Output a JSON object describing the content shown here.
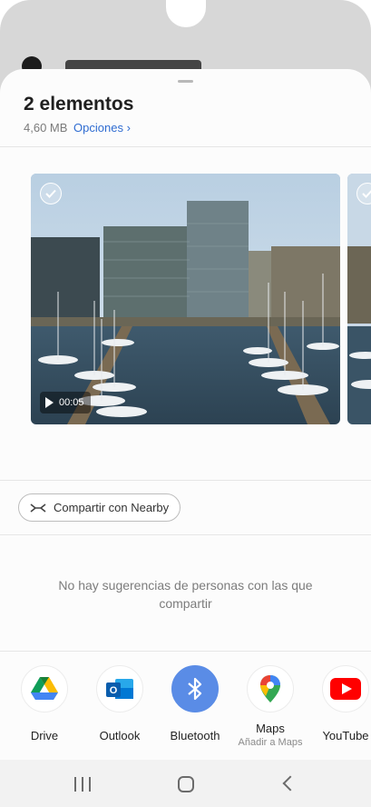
{
  "sheet": {
    "title": "2 elementos",
    "size": "4,60 MB",
    "options_label": "Opciones",
    "options_chevron": "›"
  },
  "media": [
    {
      "selected": false,
      "duration": "00:05",
      "type": "video"
    },
    {
      "selected": false,
      "type": "video"
    }
  ],
  "nearby": {
    "label": "Compartir con Nearby",
    "icon": "nearby-share-icon"
  },
  "suggestions": {
    "empty_text": "No hay sugerencias de personas con las que compartir"
  },
  "apps": [
    {
      "label": "Drive",
      "icon": "google-drive-icon"
    },
    {
      "label": "Outlook",
      "icon": "outlook-icon"
    },
    {
      "label": "Bluetooth",
      "icon": "bluetooth-icon",
      "color": "#5a8ce6"
    },
    {
      "label": "Maps",
      "sublabel": "Añadir a Maps",
      "icon": "google-maps-icon"
    },
    {
      "label": "YouTube",
      "icon": "youtube-icon",
      "color": "#ff0000"
    }
  ],
  "navbar": {
    "icons": [
      "recents-icon",
      "home-icon",
      "back-icon"
    ]
  },
  "colors": {
    "accent": "#2f6cd1",
    "sheet_bg": "#fcfcfc",
    "scrim": "#d7d7d7"
  }
}
